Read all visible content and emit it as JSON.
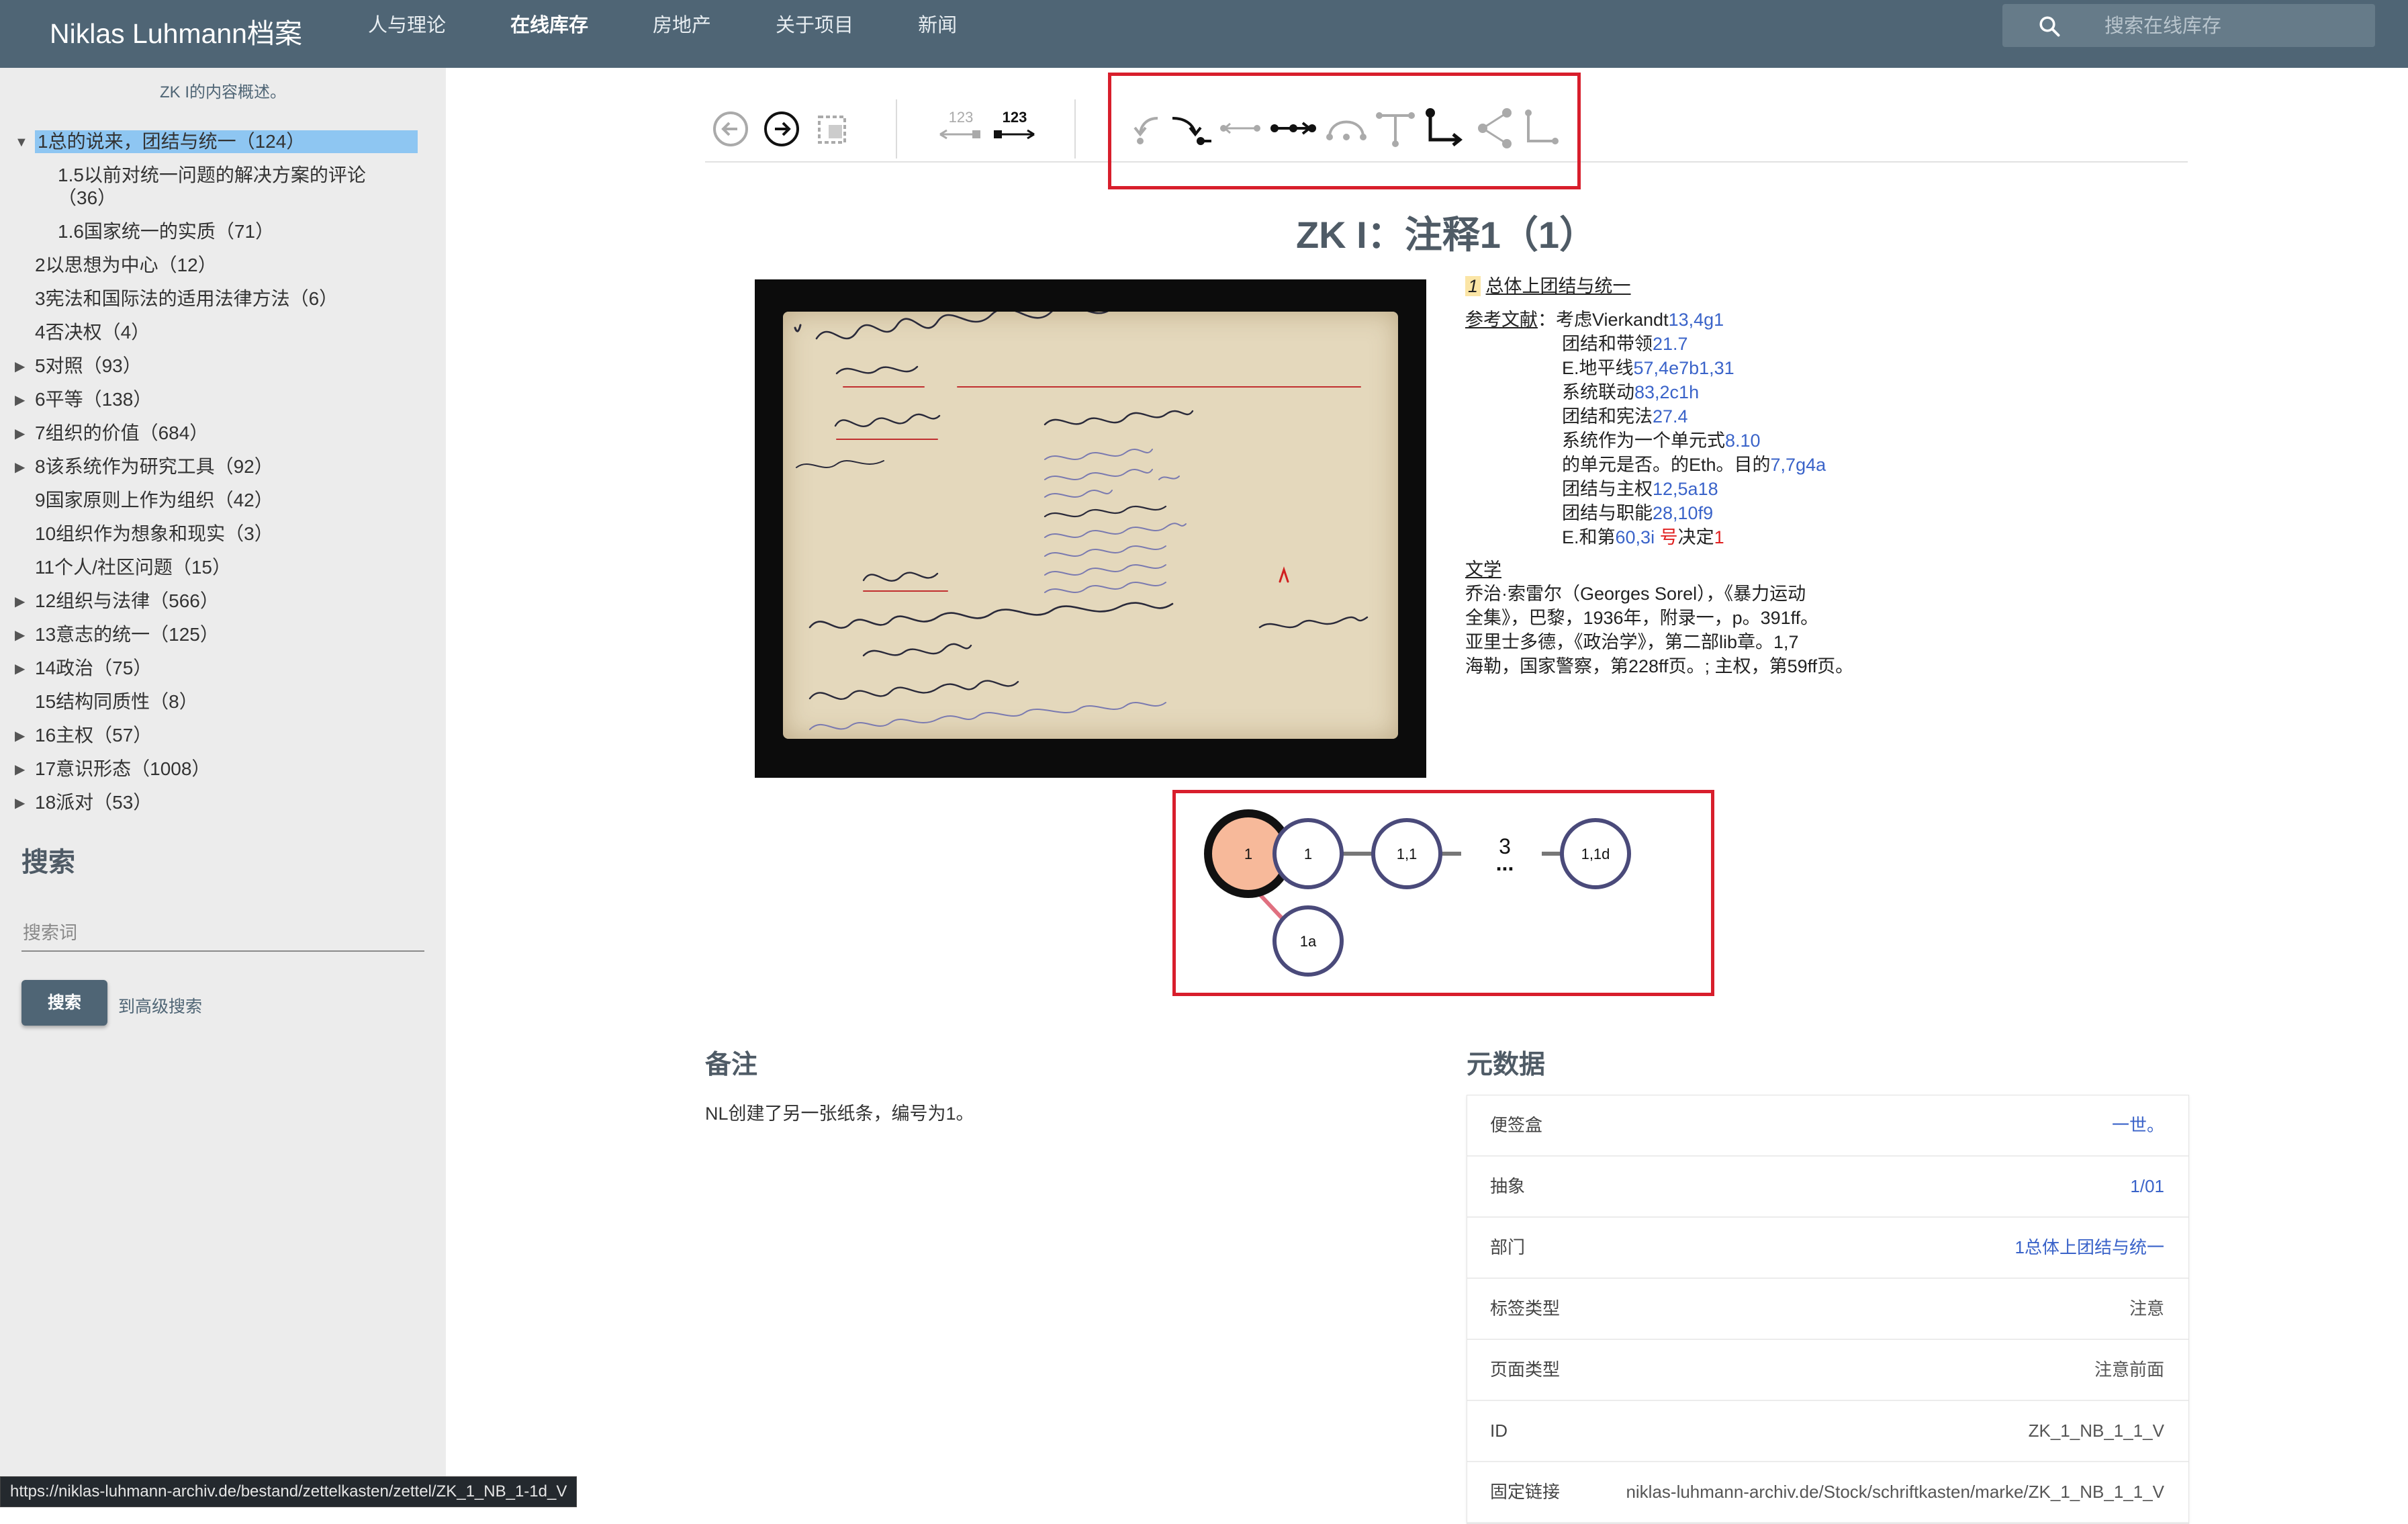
{
  "header": {
    "brand": "Niklas Luhmann档案",
    "nav": [
      "人与理论",
      "在线库存",
      "房地产",
      "关于项目",
      "新闻"
    ],
    "active_nav": "在线库存",
    "search_placeholder": "搜索在线库存"
  },
  "sidebar": {
    "caption": "ZK I的内容概述。",
    "tree": [
      {
        "caret": "▼",
        "label": "1总的说来，团结与统一（124）",
        "selected": true
      },
      {
        "caret": "",
        "label": "1.5以前对统一问题的解决方案的评论（36）",
        "sub": true
      },
      {
        "caret": "",
        "label": "1.6国家统一的实质（71）",
        "sub": true
      },
      {
        "caret": "",
        "label": "2以思想为中心（12）"
      },
      {
        "caret": "",
        "label": "3宪法和国际法的适用法律方法（6）"
      },
      {
        "caret": "",
        "label": "4否决权（4）"
      },
      {
        "caret": "▶",
        "label": "5对照（93）"
      },
      {
        "caret": "▶",
        "label": "6平等（138）"
      },
      {
        "caret": "▶",
        "label": "7组织的价值（684）"
      },
      {
        "caret": "▶",
        "label": "8该系统作为研究工具（92）"
      },
      {
        "caret": "",
        "label": "9国家原则上作为组织（42）"
      },
      {
        "caret": "",
        "label": "10组织作为想象和现实（3）"
      },
      {
        "caret": "",
        "label": "11个人/社区问题（15）"
      },
      {
        "caret": "▶",
        "label": "12组织与法律（566）"
      },
      {
        "caret": "▶",
        "label": "13意志的统一（125）"
      },
      {
        "caret": "▶",
        "label": "14政治（75）"
      },
      {
        "caret": "",
        "label": "15结构同质性（8）"
      },
      {
        "caret": "▶",
        "label": "16主权（57）"
      },
      {
        "caret": "▶",
        "label": "17意识形态（1008）"
      },
      {
        "caret": "▶",
        "label": "18派对（53）"
      }
    ],
    "search_title": "搜索",
    "search_placeholder": "搜索词",
    "search_button": "搜索",
    "advanced_link": "到高级搜索",
    "status_url": "https://niklas-luhmann-archiv.de/bestand/zettelkasten/zettel/ZK_1_NB_1-1d_V"
  },
  "toolbar": {
    "numbering_left": "123",
    "numbering_right": "123"
  },
  "page": {
    "title": "ZK I：注释1（1）"
  },
  "transcript": {
    "num": "1",
    "heading": "总体上团结与统一",
    "refs_label": "参考文献",
    "refs_lead": "：考虑Vierkandt",
    "refs_lead_link": "13,4g1",
    "refs": [
      {
        "text": "团结和带领",
        "link": "21.7"
      },
      {
        "text": "E.地平线",
        "link": "57,4e7b1,31"
      },
      {
        "text": "系统联动",
        "link": "83,2c1h"
      },
      {
        "text": "团结和宪法",
        "link": "27.4"
      },
      {
        "text": "系统作为一个单元式",
        "link": "8.10"
      },
      {
        "text": "的单元是否。的Eth。目的",
        "link": "7,7g4a"
      },
      {
        "text": "团结与主权",
        "link": "12,5a18"
      },
      {
        "text": "团结与职能",
        "link": "28,10f9"
      }
    ],
    "last_ref_text": "E.和第",
    "last_ref_link": "60,3i",
    "last_ref_red_a": " 号",
    "last_ref_mid": "决定",
    "last_ref_red_b": "1",
    "lit_label": "文学",
    "lit_lines": [
      "乔治·索雷尔（Georges Sorel），《暴力运动",
      "全集》，巴黎，1936年，附录一，p。391ff。",
      "亚里士多德，《政治学》，第二部lib章。1,7",
      "海勒，国家警察，第228ff页。; 主权，第59ff页。"
    ]
  },
  "graph": {
    "nodes": [
      "1",
      "1",
      "1,1",
      "1,1d",
      "1a"
    ],
    "ellipsis_count": "3",
    "ellipsis": "..."
  },
  "notes": {
    "title": "备注",
    "text": "NL创建了另一张纸条，编号为1。"
  },
  "metadata": {
    "title": "元数据",
    "rows": [
      {
        "k": "便签盒",
        "v": "一世。",
        "link": true
      },
      {
        "k": "抽象",
        "v": "1/01",
        "link": true
      },
      {
        "k": "部门",
        "v": "1总体上团结与统一",
        "link": true
      },
      {
        "k": "标签类型",
        "v": "注意",
        "link": false
      },
      {
        "k": "页面类型",
        "v": "注意前面",
        "link": false
      },
      {
        "k": "ID",
        "v": "ZK_1_NB_1_1_V",
        "link": false
      },
      {
        "k": "固定链接",
        "v": "niklas-luhmann-archiv.de/Stock/schriftkasten/marke/ZK_1_NB_1_1_V",
        "link": false
      }
    ]
  },
  "colors": {
    "header_bg": "#4f6575",
    "link_blue": "#3a63c9",
    "highlight_red": "#d81e2c",
    "current_node_fill": "#f7b99a",
    "node_stroke": "#4a4a7a"
  }
}
